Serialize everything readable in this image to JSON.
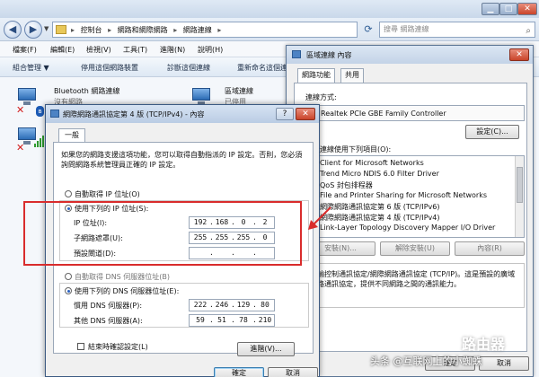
{
  "explorer": {
    "breadcrumb": [
      "控制台",
      "網路和網際網路",
      "網路連線"
    ],
    "search_placeholder": "搜尋 網路連線",
    "menu": [
      "檔案(F)",
      "編輯(E)",
      "檢視(V)",
      "工具(T)",
      "進階(N)",
      "說明(H)"
    ],
    "commands": [
      "組合管理",
      "停用這個網路裝置",
      "診斷這個連線",
      "重新命名這個連線"
    ],
    "connections": [
      {
        "name": "Bluetooth 網路連線",
        "status": "沒有網路"
      },
      {
        "name": "區域連線",
        "status": "已停用"
      }
    ]
  },
  "props_dialog": {
    "title": "區域連線 內容",
    "tabs": [
      "網路功能",
      "共用"
    ],
    "connect_using_label": "連線方式:",
    "adapter_name": "Realtek PCIe GBE Family Controller",
    "configure_label": "設定(C)...",
    "items_label": "這個連線使用下列項目(O):",
    "items": [
      {
        "label": "Client for Microsoft Networks",
        "checked": true
      },
      {
        "label": "Trend Micro NDIS 6.0 Filter Driver",
        "checked": true
      },
      {
        "label": "QoS 封包排程器",
        "checked": true
      },
      {
        "label": "File and Printer Sharing for Microsoft Networks",
        "checked": true
      },
      {
        "label": "網際網路通訊協定第 6 版 (TCP/IPv6)",
        "checked": true
      },
      {
        "label": "網際網路通訊協定第 4 版 (TCP/IPv4)",
        "checked": true
      },
      {
        "label": "Link-Layer Topology Discovery Mapper I/O Driver",
        "checked": true
      }
    ],
    "install_label": "安裝(N)...",
    "uninstall_label": "解除安裝(U)",
    "properties_label": "內容(R)",
    "description": "傳輸控制通訊協定/網際網路通訊協定 (TCP/IP)。這是預設的廣域網路通訊協定，提供不同網路之間的通訊能力。",
    "ok_label": "確定",
    "cancel_label": "取消"
  },
  "ipv4_dialog": {
    "title": "網際網路通訊協定第 4 版 (TCP/IPv4) - 內容",
    "help_label": "?",
    "tab": "一般",
    "intro": "如果您的網路支援這項功能，您可以取得自動指派的 IP 設定。否則，您必須詢問網路系統管理員正確的 IP 設定。",
    "auto_ip_label": "自動取得 IP 位址(O)",
    "manual_ip_label": "使用下列的 IP 位址(S):",
    "ip_label": "IP 位址(I):",
    "ip": [
      "192",
      "168",
      "0",
      "2"
    ],
    "mask_label": "子網路遮罩(U):",
    "mask": [
      "255",
      "255",
      "255",
      "0"
    ],
    "gateway_label": "預設閘道(D):",
    "gateway": [
      "",
      "",
      "",
      ""
    ],
    "auto_dns_label": "自動取得 DNS 伺服器位址(B)",
    "manual_dns_label": "使用下列的 DNS 伺服器位址(E):",
    "preferred_dns_label": "慣用 DNS 伺服器(P):",
    "preferred_dns": [
      "222",
      "246",
      "129",
      "80"
    ],
    "alternate_dns_label": "其他 DNS 伺服器(A):",
    "alternate_dns": [
      "59",
      "51",
      "78",
      "210"
    ],
    "validate_label": "結束時確認設定(L)",
    "advanced_label": "進階(V)...",
    "ok_label": "確定",
    "cancel_label": "取消"
  },
  "watermark": "头条 @互联网上的小蜘蛛",
  "watermark_logo": "路由器",
  "accent_color": "#d92c2c"
}
